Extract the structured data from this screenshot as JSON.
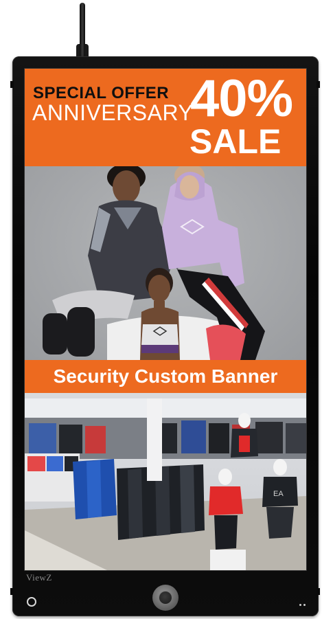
{
  "offer_banner": {
    "line1": "SPECIAL OFFER",
    "line2": "ANNIVERSARY",
    "percent": "40%",
    "sale": "SALE",
    "bg_color": "#ed6a1f"
  },
  "models_photo": {
    "hoodie_logo": "umbro",
    "sports_bra_logo": "umbro"
  },
  "security_banner": {
    "text": "Security Custom Banner",
    "bg_color": "#ed6a1f"
  },
  "store_photo": {
    "shirt_print": "EA"
  },
  "device": {
    "brand": "ViewZ",
    "camera_icon": "camera-icon",
    "home_icon": "home-button-icon",
    "indicator_icon": "status-dots-icon"
  }
}
